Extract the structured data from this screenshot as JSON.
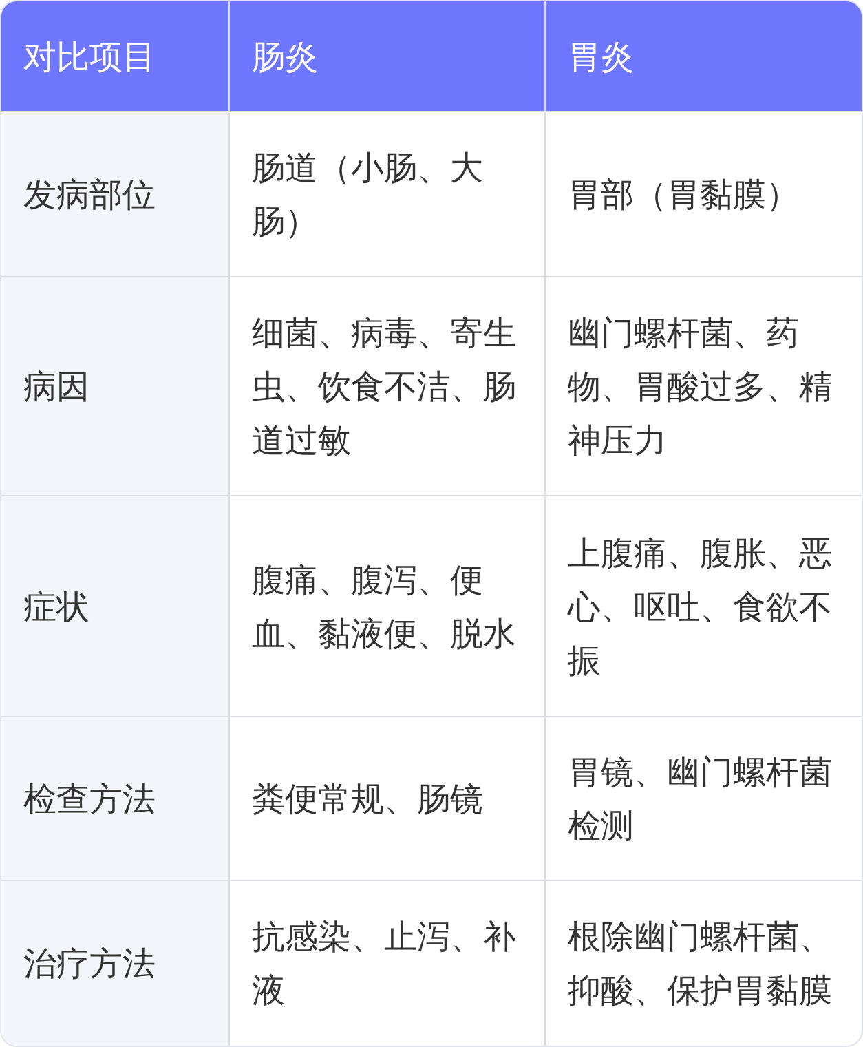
{
  "table": {
    "columns": [
      "对比项目",
      "肠炎",
      "胃炎"
    ],
    "rows": [
      {
        "cells": [
          "发病部位",
          "肠道（小肠、大肠）",
          "胃部（胃黏膜）"
        ]
      },
      {
        "cells": [
          "病因",
          "细菌、病毒、寄生虫、饮食不洁、肠道过敏",
          "幽门螺杆菌、药物、胃酸过多、精神压力"
        ]
      },
      {
        "cells": [
          "症状",
          "腹痛、腹泻、便血、黏液便、脱水",
          "上腹痛、腹胀、恶心、呕吐、食欲不振"
        ]
      },
      {
        "cells": [
          "检查方法",
          "粪便常规、肠镜",
          "胃镜、幽门螺杆菌检测"
        ]
      },
      {
        "cells": [
          "治疗方法",
          "抗感染、止泻、补液",
          "根除幽门螺杆菌、抑酸、保护胃黏膜"
        ]
      }
    ]
  }
}
